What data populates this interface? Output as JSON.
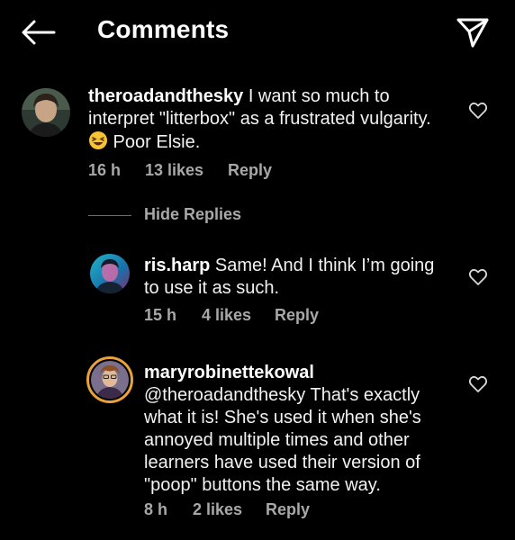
{
  "header": {
    "title": "Comments",
    "back_icon": "arrow-left-icon",
    "share_icon": "paper-plane-icon"
  },
  "comments": [
    {
      "username": "theroadandthesky",
      "text_line1": " I want so much to",
      "text_line2": "interpret \"litterbox\" as a frustrated vulgarity.",
      "text_line3": " Poor Elsie.",
      "emoji": "😆",
      "time": "16 h",
      "likes": "13 likes",
      "reply": "Reply"
    },
    {
      "username": "ris.harp",
      "text_line1": " Same! And I think I’m going",
      "text_line2": "to use it as such.",
      "time": "15 h",
      "likes": "4 likes",
      "reply": "Reply"
    },
    {
      "username": "maryrobinettekowal",
      "mention": "@theroadandthesky",
      "text_line1": " That's exactly",
      "text_line2": "what it is! She's used it when she's",
      "text_line3": "annoyed multiple times and other",
      "text_line4": "learners have used their version of",
      "text_line5": "\"poop\" buttons the same way.",
      "time": "8 h",
      "likes": "2 likes",
      "reply": "Reply"
    }
  ],
  "hide_replies_label": "Hide Replies",
  "colors": {
    "background": "#000000",
    "text": "#f2f2f2",
    "secondary": "#a8a8a8",
    "story_ring": "#e9a23b"
  }
}
